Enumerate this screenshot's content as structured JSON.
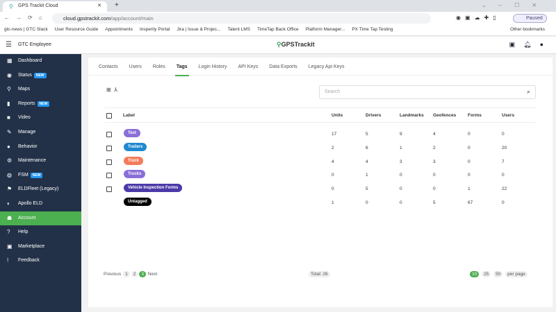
{
  "browser": {
    "tab_title": "GPS Trackit Cloud",
    "url_host": "cloud.gpstrackit.com",
    "url_path": "/app/account/main",
    "profile_status": "Paused",
    "bookmarks": [
      "gtc-news | GTC Slack",
      "User Resource Guide",
      "Appointments",
      "Insperity Portal",
      "Jira | Issue & Projec...",
      "Talent LMS",
      "TimeTap Back Office",
      "Platform Manager...",
      "PX Time Tap Testing"
    ],
    "other_bookmarks": "Other bookmarks"
  },
  "header": {
    "account": "GTC Employee",
    "logo": "GPSTrackit"
  },
  "sidebar": {
    "new_badge": "NEW",
    "items": [
      {
        "label": "Dashboard",
        "icon": "dashboard-icon",
        "glyph": "▦"
      },
      {
        "label": "Status",
        "icon": "status-icon",
        "glyph": "◉",
        "new": true
      },
      {
        "label": "Maps",
        "icon": "map-pin-icon",
        "glyph": "⚲"
      },
      {
        "label": "Reports",
        "icon": "reports-icon",
        "glyph": "▮",
        "new": true
      },
      {
        "label": "Video",
        "icon": "video-icon",
        "glyph": "■"
      },
      {
        "label": "Manage",
        "icon": "wrench-icon",
        "glyph": "✎"
      },
      {
        "label": "Behavior",
        "icon": "person-icon",
        "glyph": "●"
      },
      {
        "label": "Maintenance",
        "icon": "maintenance-icon",
        "glyph": "⚙"
      },
      {
        "label": "FSM",
        "icon": "fsm-icon",
        "glyph": "◍",
        "new": true
      },
      {
        "label": "ELDFleet (Legacy)",
        "icon": "eld-icon",
        "glyph": "⚑"
      },
      {
        "label": "Apollo ELD",
        "icon": "apollo-icon",
        "glyph": "◐"
      },
      {
        "label": "Account",
        "icon": "account-icon",
        "glyph": "☗",
        "active": true
      },
      {
        "label": "Help",
        "icon": "help-icon",
        "glyph": "?"
      },
      {
        "label": "Marketplace",
        "icon": "marketplace-icon",
        "glyph": "▣"
      },
      {
        "label": "Feedback",
        "icon": "feedback-icon",
        "glyph": "!"
      }
    ]
  },
  "tabs": [
    "Contacts",
    "Users",
    "Roles",
    "Tags",
    "Login History",
    "API Keys",
    "Data Exports",
    "Legacy Api Keys"
  ],
  "active_tab": "Tags",
  "search": {
    "placeholder": "Search"
  },
  "table": {
    "columns": [
      "Label",
      "Units",
      "Drivers",
      "Landmarks",
      "Geofences",
      "Forms",
      "Users"
    ],
    "rows": [
      {
        "label": "Test",
        "color": "#8a6fd8",
        "values": [
          "17",
          "5",
          "9",
          "4",
          "0",
          "0"
        ],
        "checkbox": true
      },
      {
        "label": "Trailers",
        "color": "#1e88d0",
        "values": [
          "2",
          "6",
          "1",
          "2",
          "0",
          "20"
        ],
        "checkbox": true
      },
      {
        "label": "Truck",
        "color": "#f37c5a",
        "values": [
          "4",
          "4",
          "3",
          "3",
          "0",
          "7"
        ],
        "checkbox": true
      },
      {
        "label": "Trucks",
        "color": "#8a6fd8",
        "values": [
          "0",
          "1",
          "0",
          "0",
          "0",
          "0"
        ],
        "checkbox": true
      },
      {
        "label": "Vehicle Inspection Forms",
        "color": "#4b3aa8",
        "values": [
          "0",
          "5",
          "0",
          "0",
          "1",
          "22"
        ],
        "checkbox": true
      },
      {
        "label": "Untagged",
        "color": "#000000",
        "values": [
          "1",
          "0",
          "0",
          "5",
          "67",
          "0"
        ],
        "checkbox": false
      }
    ]
  },
  "pagination": {
    "previous": "Previous",
    "pages": [
      "1",
      "2",
      "3"
    ],
    "current": "3",
    "next": "Next",
    "total": "Total: 26",
    "page_sizes": [
      "10",
      "25",
      "50"
    ],
    "page_size": "10",
    "per_page": "per page"
  }
}
